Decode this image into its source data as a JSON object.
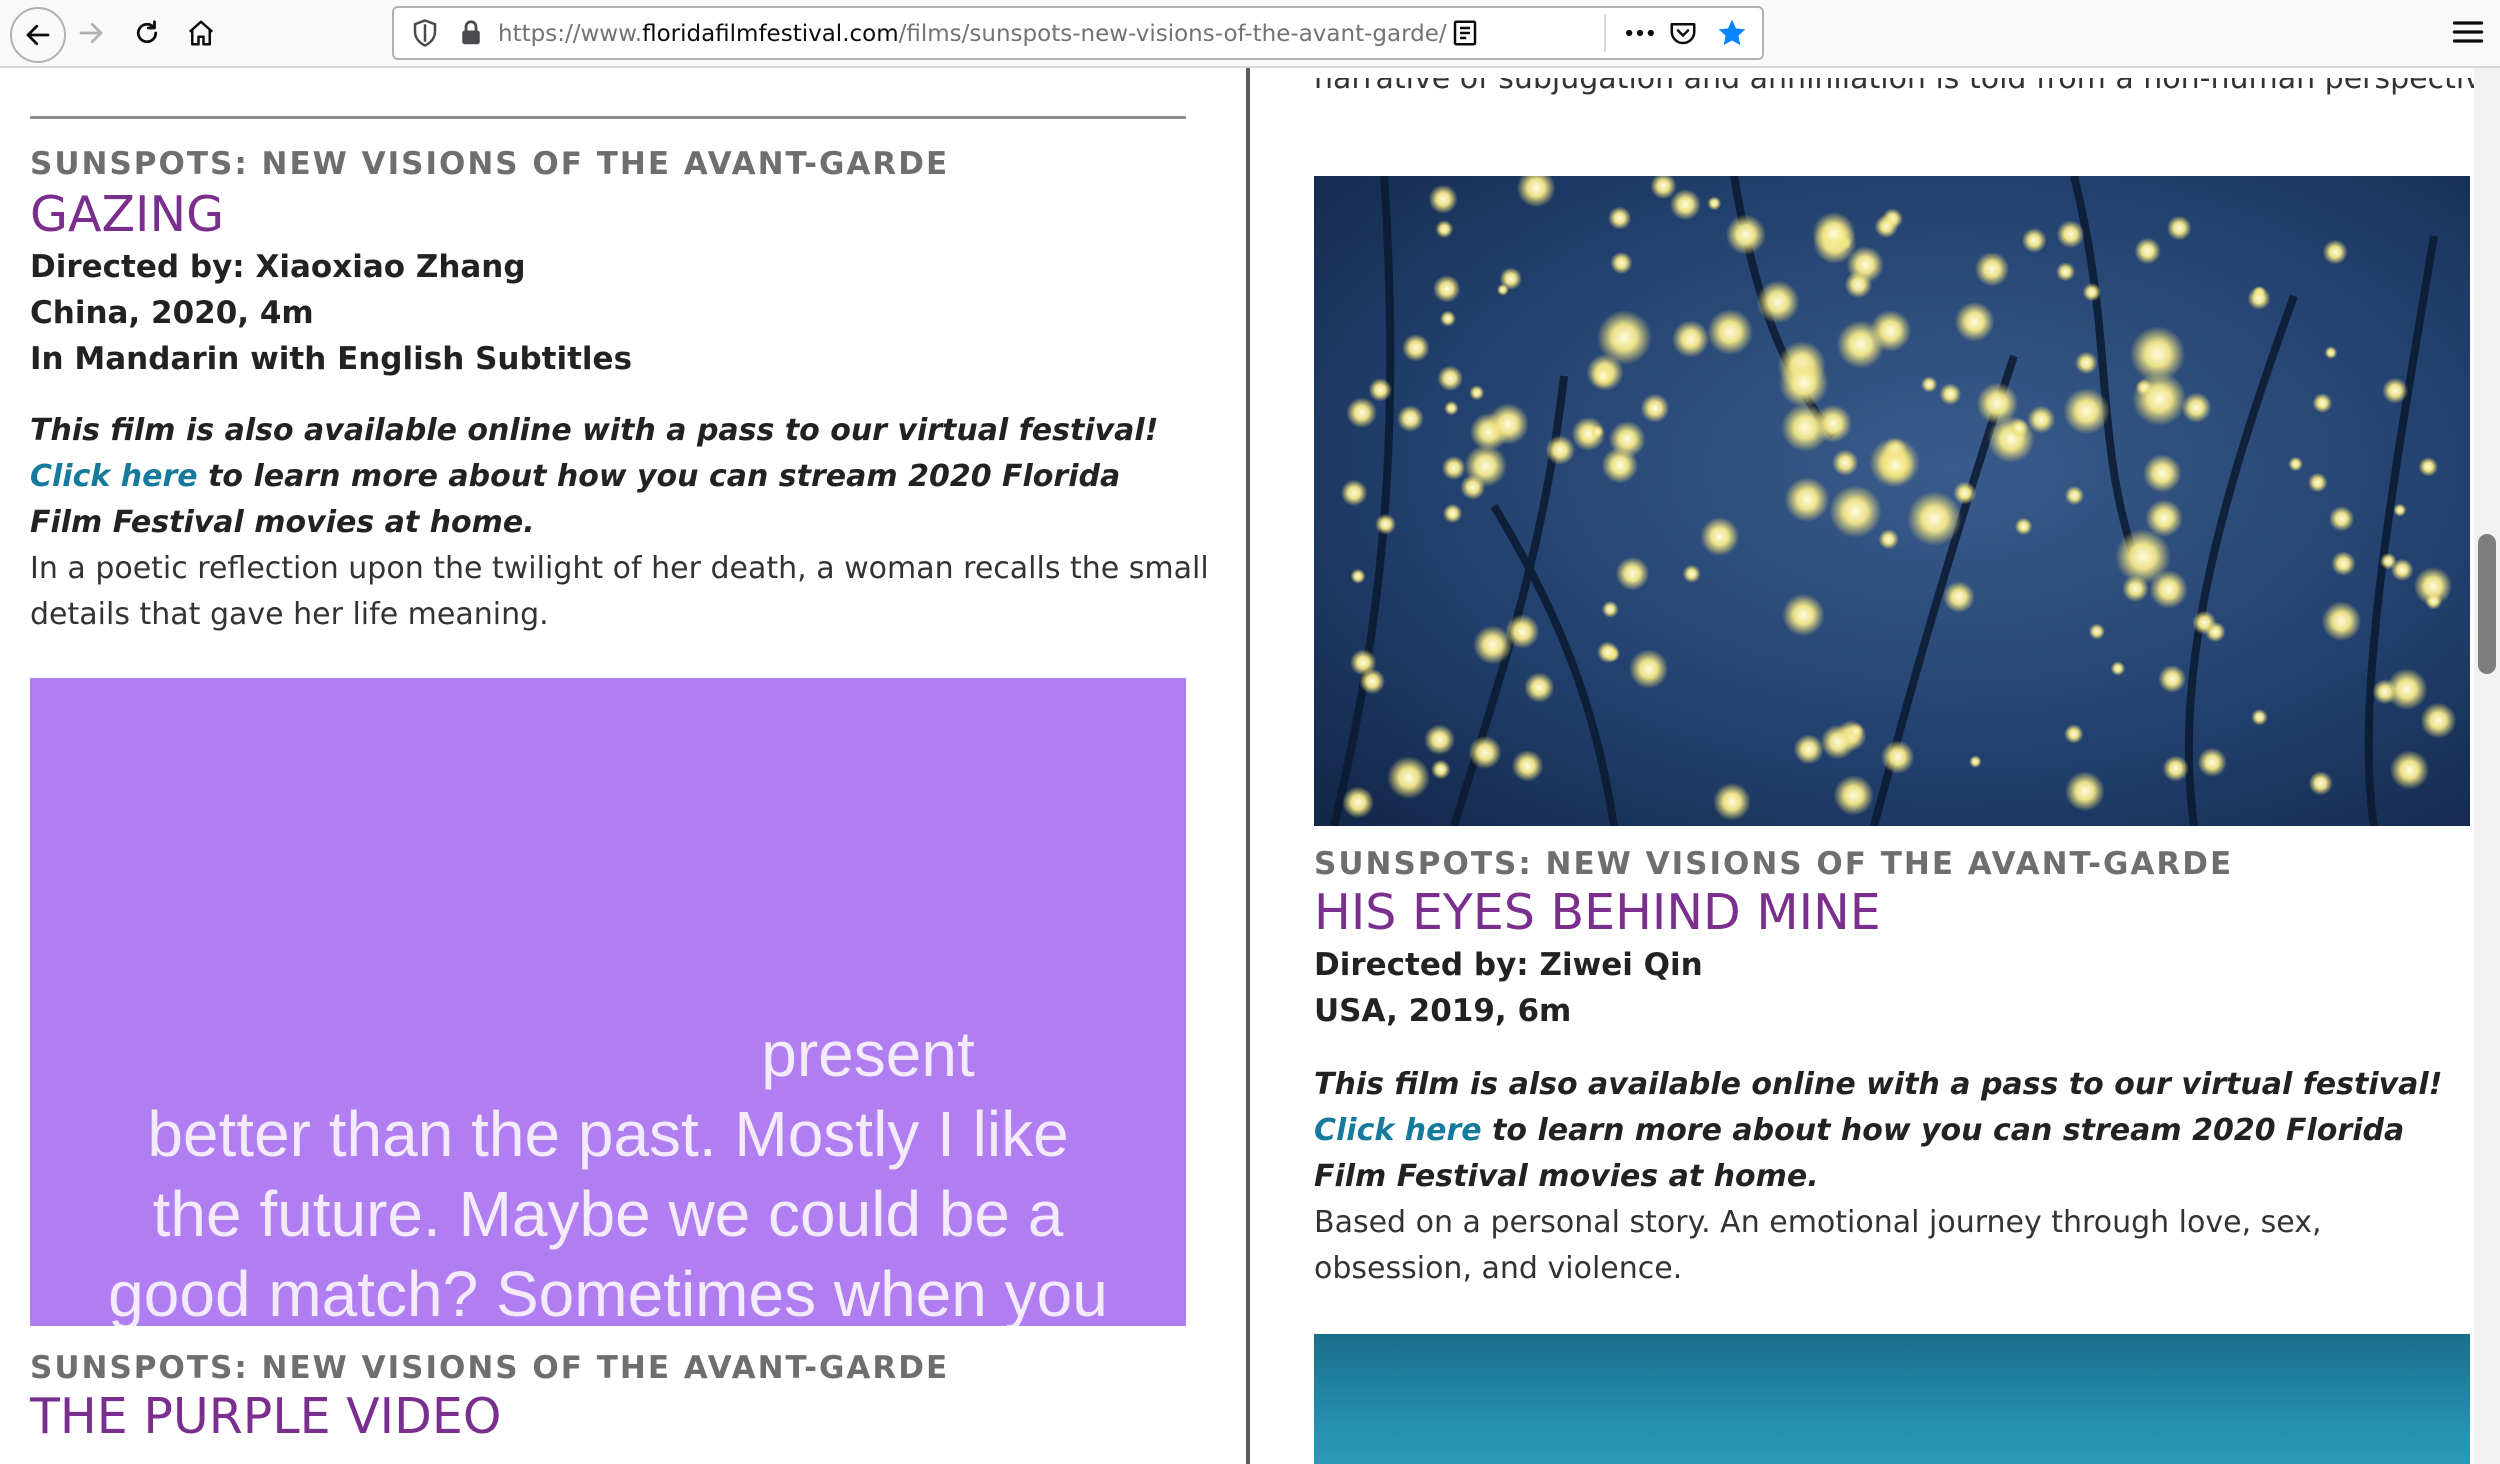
{
  "browser": {
    "url_prefix": "https://www.",
    "url_domain": "floridafilmfestival.com",
    "url_path": "/films/sunspots-new-visions-of-the-avant-garde/"
  },
  "films": {
    "cut_off_text": "narrative of subjugation and annihilation is told from a non-human perspective.",
    "gazing": {
      "category": "SUNSPOTS: NEW VISIONS OF THE AVANT-GARDE",
      "title": "GAZING",
      "director": "Directed by: Xiaoxiao Zhang",
      "country_year": "China, 2020, 4m",
      "language": "In Mandarin with English Subtitles",
      "promo_pre": "This film is also available online with a pass to our virtual festival!",
      "promo_link": "Click here",
      "promo_post": "to learn more about how you can stream 2020 Florida Film Festival movies at home.",
      "synopsis": "In a poetic reflection upon the twilight of her death, a woman recalls the small details that gave her life meaning."
    },
    "purple_still_text": {
      "line0": "present",
      "line1": "better than the past. Mostly I like",
      "line2": "the future. Maybe we could be a",
      "line3": "good match? Sometimes when you"
    },
    "purple_video": {
      "category": "SUNSPOTS: NEW VISIONS OF THE AVANT-GARDE",
      "title": "THE PURPLE VIDEO"
    },
    "his_eyes": {
      "category": "SUNSPOTS: NEW VISIONS OF THE AVANT-GARDE",
      "title": "HIS EYES BEHIND MINE",
      "director": "Directed by: Ziwei Qin",
      "country_year": "USA, 2019, 6m",
      "promo_pre": "This film is also available online with a pass to our virtual festival!",
      "promo_link": "Click here",
      "promo_post": "to learn more about how you can stream 2020 Florida Film Festival movies at home.",
      "synopsis": "Based on a personal story. An emotional journey through love, sex, obsession, and violence."
    }
  },
  "colors": {
    "title_purple": "#7a2e8e",
    "link_teal": "#167a9c",
    "category_gray": "#6e6e6e",
    "still_purple": "#b07ef0",
    "bookmark_blue": "#0a84ff"
  }
}
